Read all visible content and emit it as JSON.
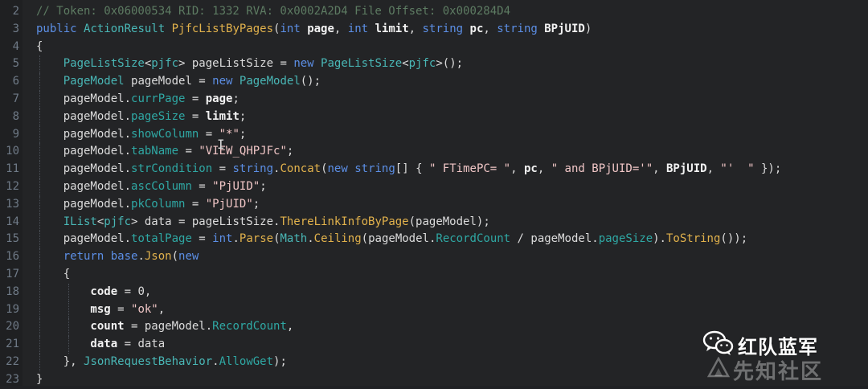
{
  "code_lines": [
    {
      "ln": "2",
      "tokens": [
        {
          "t": "// Token: 0x06000534 RID: 1332 RVA: 0x0002A2D4 File Offset: 0x000284D4",
          "c": "comment"
        }
      ]
    },
    {
      "ln": "3",
      "tokens": [
        {
          "t": "public ",
          "c": "keyword"
        },
        {
          "t": "ActionResult ",
          "c": "type"
        },
        {
          "t": "PjfcListByPages",
          "c": "method"
        },
        {
          "t": "(",
          "c": "punct"
        },
        {
          "t": "int ",
          "c": "keyword"
        },
        {
          "t": "page",
          "c": "bold"
        },
        {
          "t": ", ",
          "c": "punct"
        },
        {
          "t": "int ",
          "c": "keyword"
        },
        {
          "t": "limit",
          "c": "bold"
        },
        {
          "t": ", ",
          "c": "punct"
        },
        {
          "t": "string ",
          "c": "keyword"
        },
        {
          "t": "pc",
          "c": "bold"
        },
        {
          "t": ", ",
          "c": "punct"
        },
        {
          "t": "string ",
          "c": "keyword"
        },
        {
          "t": "BPjUID",
          "c": "bold"
        },
        {
          "t": ")",
          "c": "punct"
        }
      ]
    },
    {
      "ln": "4",
      "tokens": [
        {
          "t": "{",
          "c": "punct"
        }
      ]
    },
    {
      "ln": "5",
      "tokens": [
        {
          "t": "    PageListSize",
          "c": "type"
        },
        {
          "t": "<",
          "c": "punct"
        },
        {
          "t": "pjfc",
          "c": "type"
        },
        {
          "t": "> ",
          "c": "punct"
        },
        {
          "t": "pageListSize = ",
          "c": "text"
        },
        {
          "t": "new ",
          "c": "keyword"
        },
        {
          "t": "PageListSize",
          "c": "type"
        },
        {
          "t": "<",
          "c": "punct"
        },
        {
          "t": "pjfc",
          "c": "type"
        },
        {
          "t": ">();",
          "c": "punct"
        }
      ]
    },
    {
      "ln": "6",
      "tokens": [
        {
          "t": "    PageModel ",
          "c": "type"
        },
        {
          "t": "pageModel = ",
          "c": "text"
        },
        {
          "t": "new ",
          "c": "keyword"
        },
        {
          "t": "PageModel",
          "c": "type"
        },
        {
          "t": "();",
          "c": "punct"
        }
      ]
    },
    {
      "ln": "7",
      "tokens": [
        {
          "t": "    pageModel.",
          "c": "text"
        },
        {
          "t": "currPage",
          "c": "property"
        },
        {
          "t": " = ",
          "c": "text"
        },
        {
          "t": "page",
          "c": "bold"
        },
        {
          "t": ";",
          "c": "punct"
        }
      ]
    },
    {
      "ln": "8",
      "tokens": [
        {
          "t": "    pageModel.",
          "c": "text"
        },
        {
          "t": "pageSize",
          "c": "property"
        },
        {
          "t": " = ",
          "c": "text"
        },
        {
          "t": "limit",
          "c": "bold"
        },
        {
          "t": ";",
          "c": "punct"
        }
      ]
    },
    {
      "ln": "9",
      "tokens": [
        {
          "t": "    pageModel.",
          "c": "text"
        },
        {
          "t": "showColumn",
          "c": "property"
        },
        {
          "t": " = ",
          "c": "text"
        },
        {
          "t": "\"*\"",
          "c": "string"
        },
        {
          "t": ";",
          "c": "punct"
        }
      ]
    },
    {
      "ln": "10",
      "tokens": [
        {
          "t": "    pageModel.",
          "c": "text"
        },
        {
          "t": "tabName",
          "c": "property"
        },
        {
          "t": " = ",
          "c": "text"
        },
        {
          "t": "\"VIEW_QHPJFc\"",
          "c": "string"
        },
        {
          "t": ";",
          "c": "punct"
        }
      ]
    },
    {
      "ln": "11",
      "tokens": [
        {
          "t": "    pageModel.",
          "c": "text"
        },
        {
          "t": "strCondition",
          "c": "property"
        },
        {
          "t": " = ",
          "c": "text"
        },
        {
          "t": "string",
          "c": "keyword"
        },
        {
          "t": ".",
          "c": "punct"
        },
        {
          "t": "Concat",
          "c": "method"
        },
        {
          "t": "(",
          "c": "punct"
        },
        {
          "t": "new ",
          "c": "keyword"
        },
        {
          "t": "string",
          "c": "keyword"
        },
        {
          "t": "[] { ",
          "c": "punct"
        },
        {
          "t": "\" FTimePC= \"",
          "c": "string"
        },
        {
          "t": ", ",
          "c": "punct"
        },
        {
          "t": "pc",
          "c": "bold"
        },
        {
          "t": ", ",
          "c": "punct"
        },
        {
          "t": "\" and BPjUID='\"",
          "c": "string"
        },
        {
          "t": ", ",
          "c": "punct"
        },
        {
          "t": "BPjUID",
          "c": "bold"
        },
        {
          "t": ", ",
          "c": "punct"
        },
        {
          "t": "\"'  \"",
          "c": "string"
        },
        {
          "t": " });",
          "c": "punct"
        }
      ]
    },
    {
      "ln": "12",
      "tokens": [
        {
          "t": "    pageModel.",
          "c": "text"
        },
        {
          "t": "ascColumn",
          "c": "property"
        },
        {
          "t": " = ",
          "c": "text"
        },
        {
          "t": "\"PjUID\"",
          "c": "string"
        },
        {
          "t": ";",
          "c": "punct"
        }
      ]
    },
    {
      "ln": "13",
      "tokens": [
        {
          "t": "    pageModel.",
          "c": "text"
        },
        {
          "t": "pkColumn",
          "c": "property"
        },
        {
          "t": " = ",
          "c": "text"
        },
        {
          "t": "\"PjUID\"",
          "c": "string"
        },
        {
          "t": ";",
          "c": "punct"
        }
      ]
    },
    {
      "ln": "14",
      "tokens": [
        {
          "t": "    IList",
          "c": "type"
        },
        {
          "t": "<",
          "c": "punct"
        },
        {
          "t": "pjfc",
          "c": "type"
        },
        {
          "t": "> ",
          "c": "punct"
        },
        {
          "t": "data = pageListSize.",
          "c": "text"
        },
        {
          "t": "ThereLinkInfoByPage",
          "c": "method"
        },
        {
          "t": "(pageModel);",
          "c": "punct"
        }
      ]
    },
    {
      "ln": "15",
      "tokens": [
        {
          "t": "    pageModel.",
          "c": "text"
        },
        {
          "t": "totalPage",
          "c": "property"
        },
        {
          "t": " = ",
          "c": "text"
        },
        {
          "t": "int",
          "c": "keyword"
        },
        {
          "t": ".",
          "c": "punct"
        },
        {
          "t": "Parse",
          "c": "method"
        },
        {
          "t": "(",
          "c": "punct"
        },
        {
          "t": "Math",
          "c": "type"
        },
        {
          "t": ".",
          "c": "punct"
        },
        {
          "t": "Ceiling",
          "c": "method"
        },
        {
          "t": "(pageModel.",
          "c": "punct"
        },
        {
          "t": "RecordCount",
          "c": "property"
        },
        {
          "t": " / pageModel.",
          "c": "text"
        },
        {
          "t": "pageSize",
          "c": "property"
        },
        {
          "t": ").",
          "c": "punct"
        },
        {
          "t": "ToString",
          "c": "method"
        },
        {
          "t": "());",
          "c": "punct"
        }
      ]
    },
    {
      "ln": "16",
      "tokens": [
        {
          "t": "    return ",
          "c": "keyword"
        },
        {
          "t": "base",
          "c": "keyword"
        },
        {
          "t": ".",
          "c": "punct"
        },
        {
          "t": "Json",
          "c": "method"
        },
        {
          "t": "(",
          "c": "punct"
        },
        {
          "t": "new",
          "c": "keyword"
        }
      ]
    },
    {
      "ln": "17",
      "tokens": [
        {
          "t": "    {",
          "c": "punct"
        }
      ]
    },
    {
      "ln": "18",
      "tokens": [
        {
          "t": "        code",
          "c": "bold"
        },
        {
          "t": " = 0,",
          "c": "text"
        }
      ]
    },
    {
      "ln": "19",
      "tokens": [
        {
          "t": "        msg",
          "c": "bold"
        },
        {
          "t": " = ",
          "c": "text"
        },
        {
          "t": "\"ok\"",
          "c": "string"
        },
        {
          "t": ",",
          "c": "punct"
        }
      ]
    },
    {
      "ln": "20",
      "tokens": [
        {
          "t": "        count",
          "c": "bold"
        },
        {
          "t": " = pageModel.",
          "c": "text"
        },
        {
          "t": "RecordCount",
          "c": "property"
        },
        {
          "t": ",",
          "c": "punct"
        }
      ]
    },
    {
      "ln": "21",
      "tokens": [
        {
          "t": "        data",
          "c": "bold"
        },
        {
          "t": " = data",
          "c": "text"
        }
      ]
    },
    {
      "ln": "22",
      "tokens": [
        {
          "t": "    }, ",
          "c": "punct"
        },
        {
          "t": "JsonRequestBehavior",
          "c": "type"
        },
        {
          "t": ".",
          "c": "punct"
        },
        {
          "t": "AllowGet",
          "c": "property"
        },
        {
          "t": ");",
          "c": "punct"
        }
      ]
    },
    {
      "ln": "23",
      "tokens": [
        {
          "t": "}",
          "c": "punct"
        }
      ]
    }
  ],
  "watermark": {
    "brand": "红队蓝军",
    "site": "先知社区",
    "icon": "wechat-icon",
    "logo_icon": "xianzhi-logo-icon"
  },
  "colors": {
    "background": "#232426",
    "keyword": "#5c8fe6",
    "type": "#49b7b6",
    "method": "#e2b24c",
    "string": "#f0c6c6",
    "comment": "#5d7b62"
  }
}
